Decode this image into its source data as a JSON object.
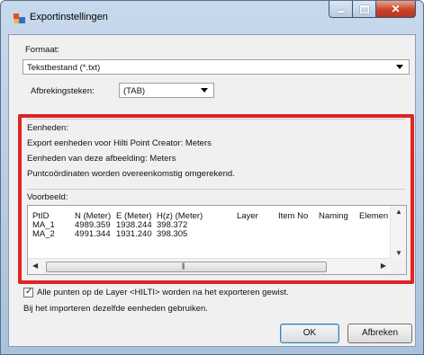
{
  "window": {
    "title": "Exportinstellingen",
    "colors": {
      "close": "#c8432a",
      "highlight": "#e02323"
    }
  },
  "format": {
    "label": "Formaat:",
    "value": "Tekstbestand (*.txt)"
  },
  "separator": {
    "label": "Afbrekingsteken:",
    "value": "(TAB)"
  },
  "units": {
    "heading": "Eenheden:",
    "line1": "Export eenheden voor Hilti Point Creator: Meters",
    "line2": "Eenheden van deze afbeelding: Meters",
    "line3": "Puntcoördinaten worden overeenkomstig omgerekend."
  },
  "preview": {
    "label": "Voorbeeld:",
    "columns": [
      "PtID",
      "N (Meter)",
      "E (Meter)",
      "H(z) (Meter)",
      "Layer",
      "Item No",
      "Naming",
      "Elemen"
    ],
    "rows": [
      [
        "MA_1",
        "4989.359",
        "1938.244",
        "398.372"
      ],
      [
        "MA_2",
        "4991.344",
        "1931.240",
        "398.305"
      ]
    ]
  },
  "options": {
    "delete_checkbox": "Alle punten op de Layer <HILTI> worden na het exporteren gewist.",
    "delete_checked": true,
    "import_note": "Bij het importeren dezelfde eenheden gebruiken."
  },
  "buttons": {
    "ok": "OK",
    "cancel": "Afbreken"
  }
}
